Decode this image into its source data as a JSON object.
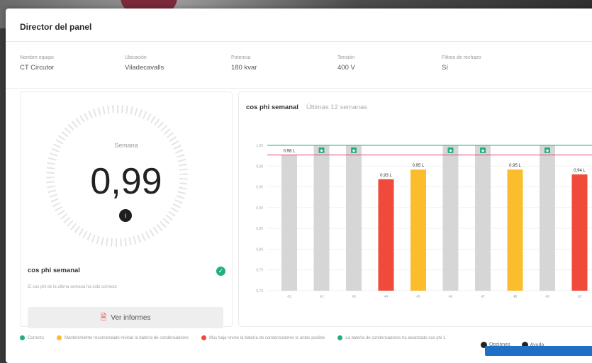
{
  "header": {
    "title": "Director del panel"
  },
  "meta": [
    {
      "label": "Nombre equipo",
      "value": "CT Circutor"
    },
    {
      "label": "Ubicación",
      "value": "Viladecavalls"
    },
    {
      "label": "Potencia",
      "value": "180 kvar"
    },
    {
      "label": "Tensión",
      "value": "400 V"
    },
    {
      "label": "Filtros de rechazo",
      "value": "Sí"
    }
  ],
  "left_card": {
    "gauge_label": "Semana",
    "gauge_value": "0,99",
    "title": "cos phi semanal",
    "description": "El cos phi de la última semana ha sido correcto",
    "report_button": "Ver informes"
  },
  "right_card": {
    "title": "cos phi semanal",
    "subtitle": "Últimas 12 semanas"
  },
  "chart_data": {
    "type": "bar",
    "categories": [
      "41",
      "42",
      "43",
      "44",
      "45",
      "46",
      "47",
      "48",
      "49",
      "50"
    ],
    "values": [
      0.98,
      1.0,
      1.0,
      0.93,
      0.95,
      1.0,
      1.0,
      0.95,
      1.0,
      0.94
    ],
    "bar_colors": [
      "#d6d6d6",
      "#d6d6d6",
      "#d6d6d6",
      "#f04a3a",
      "#fbbd2e",
      "#d6d6d6",
      "#d6d6d6",
      "#fbbd2e",
      "#d6d6d6",
      "#f04a3a"
    ],
    "star_markers": [
      false,
      true,
      true,
      false,
      false,
      true,
      true,
      false,
      true,
      false
    ],
    "data_labels": [
      "0,98 L",
      "",
      "",
      "0,93 L",
      "0,95 L",
      "",
      "",
      "0,95 L",
      "",
      "0,94 L"
    ],
    "y_ticks": [
      "1,00",
      "0,98",
      "0,95",
      "0,90",
      "0,85",
      "0,80",
      "0,75",
      "0,70"
    ],
    "reference_lines": [
      {
        "value": 1.0,
        "color": "#22b07a"
      },
      {
        "value": 0.98,
        "color": "#e04a7a"
      }
    ],
    "ylim": [
      0.7,
      1.0
    ],
    "title": "cos phi semanal",
    "xlabel": "",
    "ylabel": ""
  },
  "legend": [
    {
      "label": "Correcto",
      "color": "#22b07a"
    },
    {
      "label": "Mantenimiento recomendado revisar la batería de condensadores",
      "color": "#fbbd2e"
    },
    {
      "label": "Muy baja revise la batería de condensadores lo antes posible",
      "color": "#f04a3a"
    },
    {
      "label": "La batería de condensadores ha alcanzado cos phi 1",
      "color": "#22b07a"
    }
  ],
  "bottom_right": {
    "item1": "Opciones",
    "item2": "Ayuda"
  },
  "colors": {
    "accent": "#1f6fc6",
    "ok": "#22b07a",
    "warn": "#fbbd2e",
    "bad": "#f04a3a"
  }
}
